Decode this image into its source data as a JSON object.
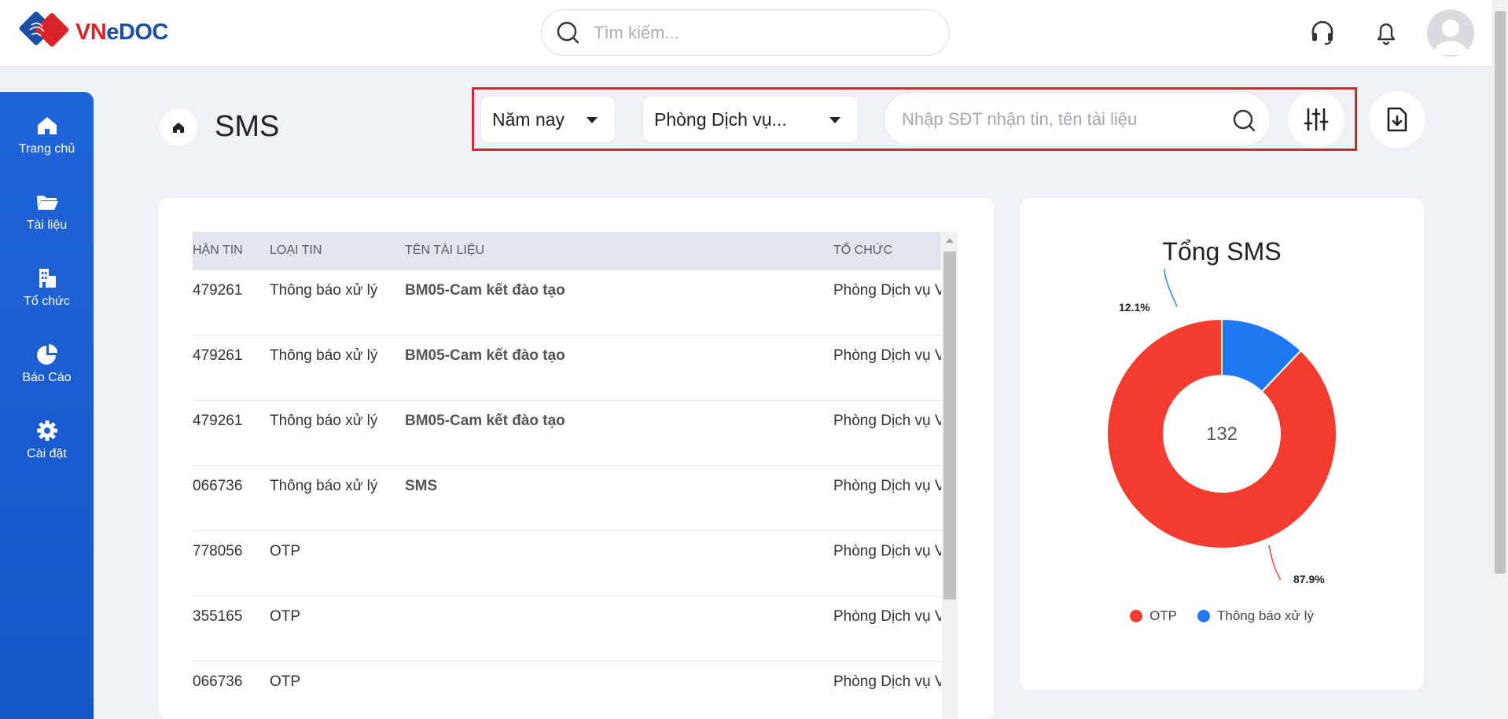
{
  "brand": {
    "name_vn": "VN",
    "name_edoc": "eDOC"
  },
  "header": {
    "search_placeholder": "Tìm kiếm..."
  },
  "sidebar": {
    "items": [
      {
        "label": "Trang chủ",
        "icon": "home-icon"
      },
      {
        "label": "Tài liệu",
        "icon": "folder-icon"
      },
      {
        "label": "Tổ chức",
        "icon": "building-icon"
      },
      {
        "label": "Báo Cáo",
        "icon": "pie-chart-icon"
      },
      {
        "label": "Cài đặt",
        "icon": "gear-icon"
      }
    ]
  },
  "page": {
    "title": "SMS"
  },
  "filters": {
    "period": "Năm nay",
    "department": "Phòng Dịch vụ...",
    "search_placeholder": "Nhập SĐT nhận tin, tên tài liệu"
  },
  "table": {
    "columns": [
      "HẬN TIN",
      "LOẠI TIN",
      "TÊN TÀI LIỆU",
      "TỔ CHỨC"
    ],
    "rows": [
      [
        "479261",
        "Thông báo xử lý",
        "BM05-Cam kết đào tạo",
        "Phòng Dịch vụ V"
      ],
      [
        "479261",
        "Thông báo xử lý",
        "BM05-Cam kết đào tạo",
        "Phòng Dịch vụ V"
      ],
      [
        "479261",
        "Thông báo xử lý",
        "BM05-Cam kết đào tạo",
        "Phòng Dịch vụ V"
      ],
      [
        "066736",
        "Thông báo xử lý",
        "SMS",
        "Phòng Dịch vụ V"
      ],
      [
        "778056",
        "OTP",
        "",
        "Phòng Dịch vụ V"
      ],
      [
        "355165",
        "OTP",
        "",
        "Phòng Dịch vụ V"
      ],
      [
        "066736",
        "OTP",
        "",
        "Phòng Dịch vụ V"
      ]
    ]
  },
  "chart_data": {
    "type": "pie",
    "title": "Tổng SMS",
    "center_label": "132",
    "categories": [
      "OTP",
      "Thông báo xử lý"
    ],
    "values": [
      87.9,
      12.1
    ],
    "labels": [
      "87.9%",
      "12.1%"
    ],
    "colors": [
      "#f43b2f",
      "#1f78f2"
    ],
    "legend_position": "bottom"
  }
}
